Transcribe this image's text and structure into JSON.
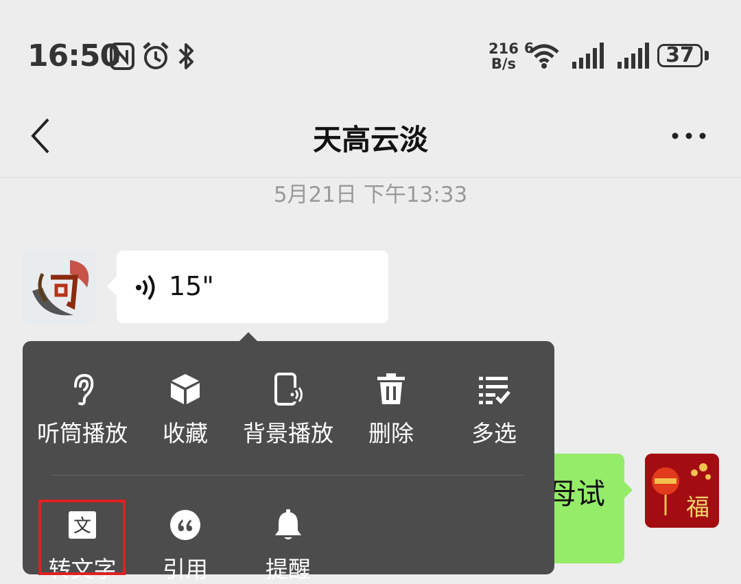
{
  "status_bar": {
    "time": "16:50",
    "net_speed_value": "216",
    "net_speed_unit": "B/s",
    "wifi_badge": "6",
    "battery": "37",
    "icons": [
      "nfc-icon",
      "alarm-icon",
      "bluetooth-icon",
      "wifi-icon",
      "signal-icon",
      "signal-icon",
      "battery-icon"
    ]
  },
  "nav": {
    "title": "天高云淡",
    "back_icon": "chevron-left-icon",
    "more_icon": "more-icon"
  },
  "chat": {
    "timestamp": "5月21日 下午13:33",
    "voice_message": {
      "duration": "15\"",
      "icon": "voice-wave-icon"
    },
    "right_message_visible_text": "母试"
  },
  "context_menu": {
    "row1": [
      {
        "label": "听筒播放",
        "icon": "ear-icon"
      },
      {
        "label": "收藏",
        "icon": "cube-icon"
      },
      {
        "label": "背景播放",
        "icon": "background-play-icon"
      },
      {
        "label": "删除",
        "icon": "trash-icon"
      },
      {
        "label": "多选",
        "icon": "multiselect-icon"
      }
    ],
    "row2": [
      {
        "label": "转文字",
        "icon": "text-convert-icon",
        "highlighted": true
      },
      {
        "label": "引用",
        "icon": "quote-icon"
      },
      {
        "label": "提醒",
        "icon": "bell-icon"
      }
    ]
  },
  "colors": {
    "background": "#ededed",
    "bubble_white": "#ffffff",
    "bubble_green": "#95ec69",
    "menu_bg": "#4c4c4c",
    "highlight": "#e02020"
  }
}
